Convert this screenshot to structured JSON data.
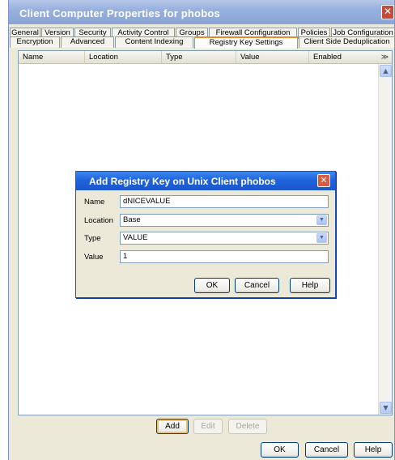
{
  "window": {
    "title": "Client Computer Properties for phobos",
    "close_glyph": "✕"
  },
  "tabs": {
    "row1": [
      {
        "label": "General"
      },
      {
        "label": "Version"
      },
      {
        "label": "Security"
      },
      {
        "label": "Activity Control"
      },
      {
        "label": "Groups"
      },
      {
        "label": "Firewall Configuration"
      },
      {
        "label": "Policies"
      },
      {
        "label": "Job Configuration"
      }
    ],
    "row2": [
      {
        "label": "Encryption"
      },
      {
        "label": "Advanced"
      },
      {
        "label": "Content Indexing"
      },
      {
        "label": "Registry Key Settings",
        "active": true
      },
      {
        "label": "Client Side Deduplication"
      }
    ]
  },
  "table": {
    "columns": [
      "Name",
      "Location",
      "Type",
      "Value",
      "Enabled"
    ],
    "column_menu_glyph": "≫",
    "rows": []
  },
  "list_actions": {
    "add": "Add",
    "edit": "Edit",
    "delete": "Delete"
  },
  "dialog": {
    "title": "Add Registry Key on Unix Client  phobos",
    "close_glyph": "✕",
    "fields": {
      "name": {
        "label": "Name",
        "value": "dNICEVALUE"
      },
      "location": {
        "label": "Location",
        "value": "Base"
      },
      "type": {
        "label": "Type",
        "value": "VALUE"
      },
      "value": {
        "label": "Value",
        "value": "1"
      }
    },
    "buttons": {
      "ok": "OK",
      "cancel": "Cancel",
      "help": "Help"
    }
  },
  "footer": {
    "ok": "OK",
    "cancel": "Cancel",
    "help": "Help"
  },
  "colors": {
    "window_titlebar": "#97b0de",
    "dialog_titlebar": "#1f63dc",
    "active_tab_accent": "#e68b2c",
    "dialog_background": "#ece9d8"
  }
}
